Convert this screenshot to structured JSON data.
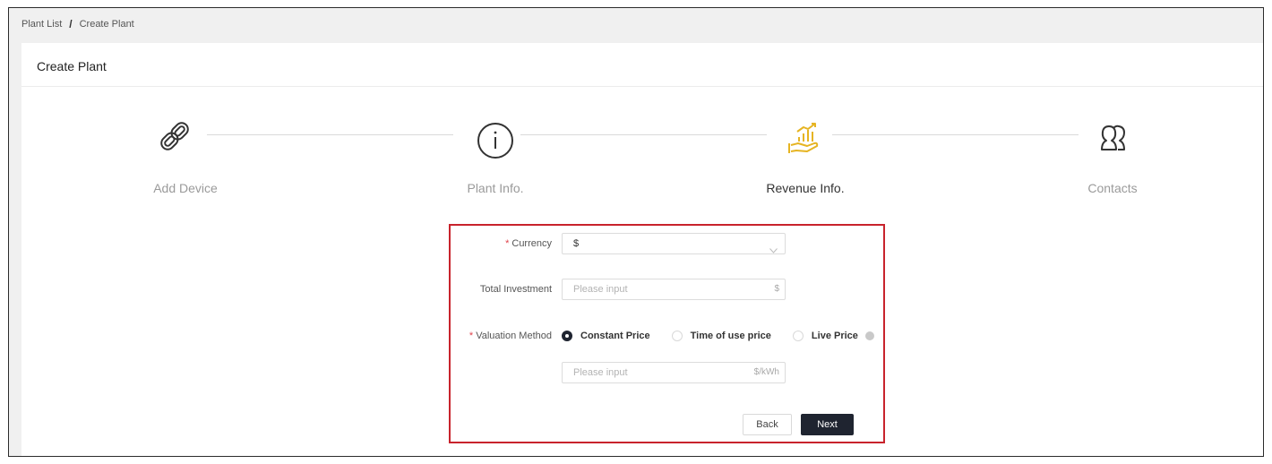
{
  "breadcrumb": {
    "parent": "Plant List",
    "separator": "/",
    "current": "Create Plant"
  },
  "card": {
    "title": "Create Plant"
  },
  "steps": [
    {
      "label": "Add Device",
      "icon": "link-icon",
      "state": "done"
    },
    {
      "label": "Plant Info.",
      "icon": "info-circle-icon",
      "state": "done"
    },
    {
      "label": "Revenue Info.",
      "icon": "revenue-hand-icon",
      "state": "active"
    },
    {
      "label": "Contacts",
      "icon": "contacts-icon",
      "state": "pending"
    }
  ],
  "form": {
    "currency": {
      "label": "Currency",
      "required": "*",
      "value": "$"
    },
    "total_investment": {
      "label": "Total Investment",
      "placeholder": "Please input",
      "suffix": "$"
    },
    "valuation_method": {
      "label": "Valuation Method",
      "required": "*",
      "options": [
        {
          "label": "Constant Price",
          "checked": true
        },
        {
          "label": "Time of use price",
          "checked": false
        },
        {
          "label": "Live Price",
          "checked": false
        }
      ]
    },
    "price_input": {
      "placeholder": "Please input",
      "suffix": "$/kWh"
    },
    "buttons": {
      "back": "Back",
      "next": "Next"
    }
  },
  "colors": {
    "active_step": "#e6b422",
    "highlight_border": "#c8232c",
    "primary_button": "#1f2430"
  }
}
